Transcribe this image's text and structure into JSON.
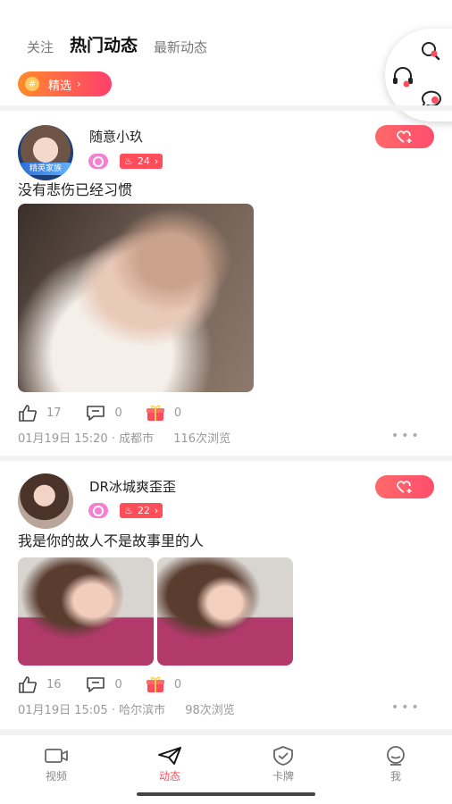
{
  "header": {
    "tabs": [
      {
        "label": "关注"
      },
      {
        "label": "热门动态"
      },
      {
        "label": "最新动态"
      }
    ],
    "featured_label": "精选",
    "featured_icon": "#"
  },
  "side_panel": {
    "icons": [
      "search-icon",
      "headset-icon",
      "chat-bubble-icon"
    ]
  },
  "posts": [
    {
      "username": "随意小玖",
      "avatar_badge": "精英家族",
      "level": "24",
      "text": "没有悲伤已经习惯",
      "likes": "17",
      "comments": "0",
      "gifts": "0",
      "date": "01月19日 15:20",
      "location": "成都市",
      "views": "116次浏览"
    },
    {
      "username": "DR冰城爽歪歪",
      "level": "22",
      "text": "我是你的故人不是故事里的人",
      "likes": "16",
      "comments": "0",
      "gifts": "0",
      "date": "01月19日 15:05",
      "location": "哈尔滨市",
      "views": "98次浏览"
    }
  ],
  "meta_separator": "·",
  "more_dots": "•••",
  "bottom_nav": [
    {
      "label": "视频",
      "icon": "video-icon"
    },
    {
      "label": "动态",
      "icon": "paper-plane-icon"
    },
    {
      "label": "卡牌",
      "icon": "shield-check-icon"
    },
    {
      "label": "我",
      "icon": "profile-icon"
    }
  ],
  "colors": {
    "accent": "#ff4b5c",
    "featured_gradient_start": "#ff8a2a",
    "featured_gradient_end": "#ff3f6c",
    "badge_pink": "#f47fd3"
  }
}
